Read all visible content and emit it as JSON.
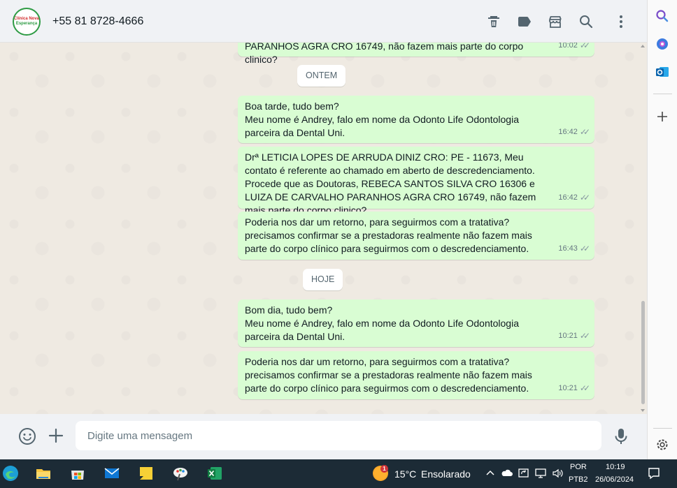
{
  "header": {
    "avatar_line1": "Clínica Nova",
    "avatar_line2": "Esperança",
    "contact_name": "+55 81 8728-4666",
    "icons": [
      "trash-icon",
      "label-icon",
      "store-icon",
      "search-icon",
      "menu-icon"
    ]
  },
  "messages": [
    {
      "id": "m0",
      "text": "PARANHOS AGRA CRO 16749, não fazem mais parte do corpo clinico?",
      "time": "10:02"
    },
    {
      "id": "m1",
      "text": "Boa tarde, tudo bem?\nMeu nome é Andrey, falo em nome da Odonto Life Odontologia parceira da Dental Uni.",
      "time": "16:42"
    },
    {
      "id": "m2",
      "text": "Drª LETICIA LOPES DE ARRUDA DINIZ CRO: PE - 11673, Meu contato é referente ao chamado em aberto de descredenciamento. Procede que as Doutoras, REBECA SANTOS SILVA  CRO 16306 e LUIZA DE CARVALHO PARANHOS AGRA CRO 16749, não fazem mais parte do corpo clinico?",
      "time": "16:42"
    },
    {
      "id": "m3",
      "text": "Poderia nos dar um retorno, para seguirmos com a tratativa? precisamos confirmar se a prestadoras realmente não fazem mais parte do corpo clínico para seguirmos com o descredenciamento.",
      "time": "16:43"
    },
    {
      "id": "m4",
      "text": "Bom dia, tudo bem?\nMeu nome é Andrey, falo em nome da Odonto Life Odontologia parceira da Dental Uni.",
      "time": "10:21"
    },
    {
      "id": "m5",
      "text": "Poderia nos dar um retorno, para seguirmos com a tratativa? precisamos confirmar se a prestadoras realmente não fazem mais parte do corpo clínico para seguirmos com o descredenciamento.",
      "time": "10:21"
    }
  ],
  "date_chips": {
    "yesterday": "ONTEM",
    "today": "HOJE"
  },
  "composer": {
    "placeholder": "Digite uma mensagem"
  },
  "taskbar": {
    "weather_badge": "1",
    "weather_temp": "15°C",
    "weather_desc": "Ensolarado",
    "lang_line1": "POR",
    "lang_line2": "PTB2",
    "time": "10:19",
    "date": "26/06/2024"
  },
  "colors": {
    "outgoing_bubble": "#d9fdd3",
    "chat_background": "#efeae2",
    "header_background": "#f0f2f5",
    "taskbar_background": "#1c2b36"
  }
}
